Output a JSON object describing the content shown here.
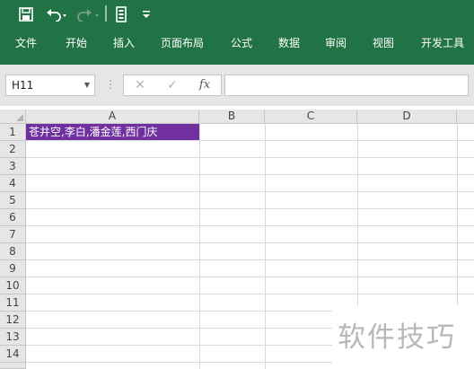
{
  "ribbon": {
    "qat": {
      "save_icon": "save-icon",
      "undo_icon": "undo-icon",
      "redo_icon": "redo-icon",
      "touch_icon": "touch-mode-icon",
      "customize_icon": "customize-qat-icon"
    },
    "tabs": [
      "文件",
      "开始",
      "插入",
      "页面布局",
      "公式",
      "数据",
      "审阅",
      "视图",
      "开发工具"
    ]
  },
  "formula_bar": {
    "name_box": "H11",
    "cancel_icon": "✕",
    "enter_icon": "✓",
    "fx_label": "fx",
    "value": ""
  },
  "sheet": {
    "columns": [
      "A",
      "B",
      "C",
      "D"
    ],
    "rows": [
      "1",
      "2",
      "3",
      "4",
      "5",
      "6",
      "7",
      "8",
      "9",
      "10",
      "11",
      "12",
      "13",
      "14"
    ],
    "cells": {
      "A1": "苍井空,李白,潘金莲,西门庆"
    }
  },
  "colors": {
    "ribbon": "#217346",
    "cell_fill": "#7030a0"
  },
  "watermark": "软件技巧"
}
